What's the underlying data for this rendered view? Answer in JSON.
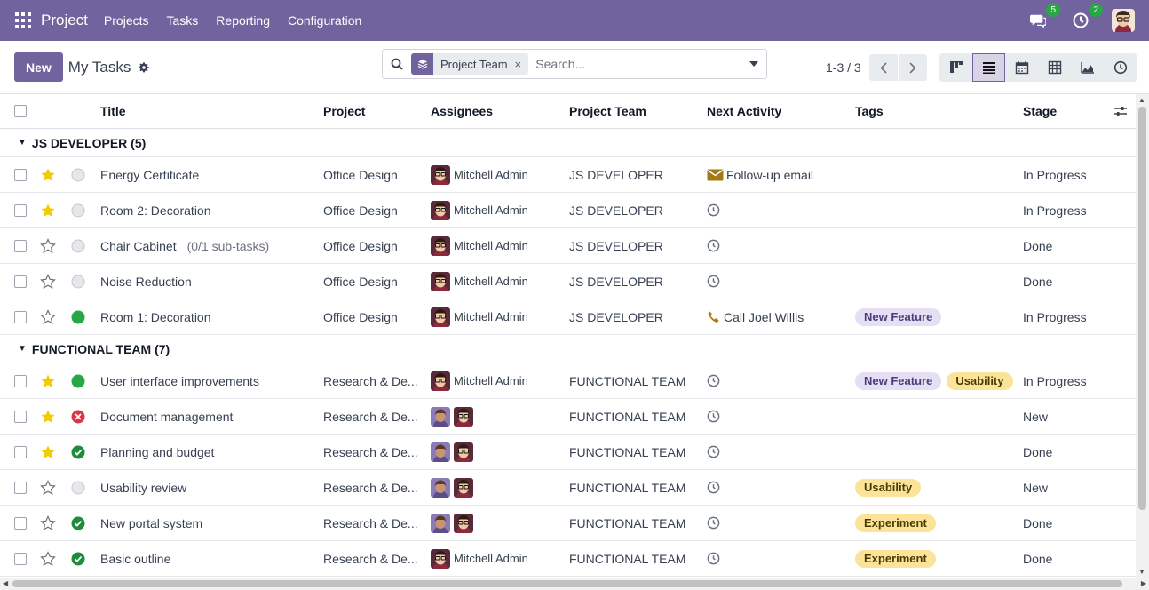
{
  "navbar": {
    "app_name": "Project",
    "menus": [
      "Projects",
      "Tasks",
      "Reporting",
      "Configuration"
    ],
    "messages_count": "5",
    "activities_count": "2"
  },
  "control": {
    "new_label": "New",
    "title": "My Tasks",
    "facet_label": "Project Team",
    "search_placeholder": "Search...",
    "pager": "1-3 / 3"
  },
  "columns": {
    "title": "Title",
    "project": "Project",
    "assignees": "Assignees",
    "team": "Project Team",
    "activity": "Next Activity",
    "tags": "Tags",
    "stage": "Stage"
  },
  "groups": [
    {
      "label": "JS DEVELOPER (5)"
    },
    {
      "label": "FUNCTIONAL TEAM (7)"
    }
  ],
  "rows": [
    {
      "title": "Energy Certificate",
      "subtask": "",
      "project": "Office Design",
      "assignee": "Mitchell Admin",
      "team": "JS DEVELOPER",
      "activity": "Follow-up email",
      "stage": "In Progress"
    },
    {
      "title": "Room 2: Decoration",
      "subtask": "",
      "project": "Office Design",
      "assignee": "Mitchell Admin",
      "team": "JS DEVELOPER",
      "activity": "",
      "stage": "In Progress"
    },
    {
      "title": "Chair Cabinet",
      "subtask": "(0/1 sub-tasks)",
      "project": "Office Design",
      "assignee": "Mitchell Admin",
      "team": "JS DEVELOPER",
      "activity": "",
      "stage": "Done"
    },
    {
      "title": "Noise Reduction",
      "subtask": "",
      "project": "Office Design",
      "assignee": "Mitchell Admin",
      "team": "JS DEVELOPER",
      "activity": "",
      "stage": "Done"
    },
    {
      "title": "Room 1: Decoration",
      "subtask": "",
      "project": "Office Design",
      "assignee": "Mitchell Admin",
      "team": "JS DEVELOPER",
      "activity": "Call Joel Willis",
      "tag1": "New Feature",
      "stage": "In Progress"
    },
    {
      "title": "User interface improvements",
      "subtask": "",
      "project": "Research & De...",
      "assignee": "Mitchell Admin",
      "team": "FUNCTIONAL TEAM",
      "activity": "",
      "tag1": "New Feature",
      "tag2": "Usability",
      "stage": "In Progress"
    },
    {
      "title": "Document management",
      "subtask": "",
      "project": "Research & De...",
      "assignee": "",
      "team": "FUNCTIONAL TEAM",
      "activity": "",
      "stage": "New"
    },
    {
      "title": "Planning and budget",
      "subtask": "",
      "project": "Research & De...",
      "assignee": "",
      "team": "FUNCTIONAL TEAM",
      "activity": "",
      "stage": "Done"
    },
    {
      "title": "Usability review",
      "subtask": "",
      "project": "Research & De...",
      "assignee": "",
      "team": "FUNCTIONAL TEAM",
      "activity": "",
      "tag1": "Usability",
      "stage": "New"
    },
    {
      "title": "New portal system",
      "subtask": "",
      "project": "Research & De...",
      "assignee": "",
      "team": "FUNCTIONAL TEAM",
      "activity": "",
      "tag1": "Experiment",
      "stage": "Done"
    },
    {
      "title": "Basic outline",
      "subtask": "",
      "project": "Research & De...",
      "assignee": "Mitchell Admin",
      "team": "FUNCTIONAL TEAM",
      "activity": "",
      "tag1": "Experiment",
      "stage": "Done"
    }
  ],
  "colors": {
    "brand": "#71639e",
    "star": "#f3cc00",
    "done": "#28a745",
    "blocked": "#dc3545"
  }
}
